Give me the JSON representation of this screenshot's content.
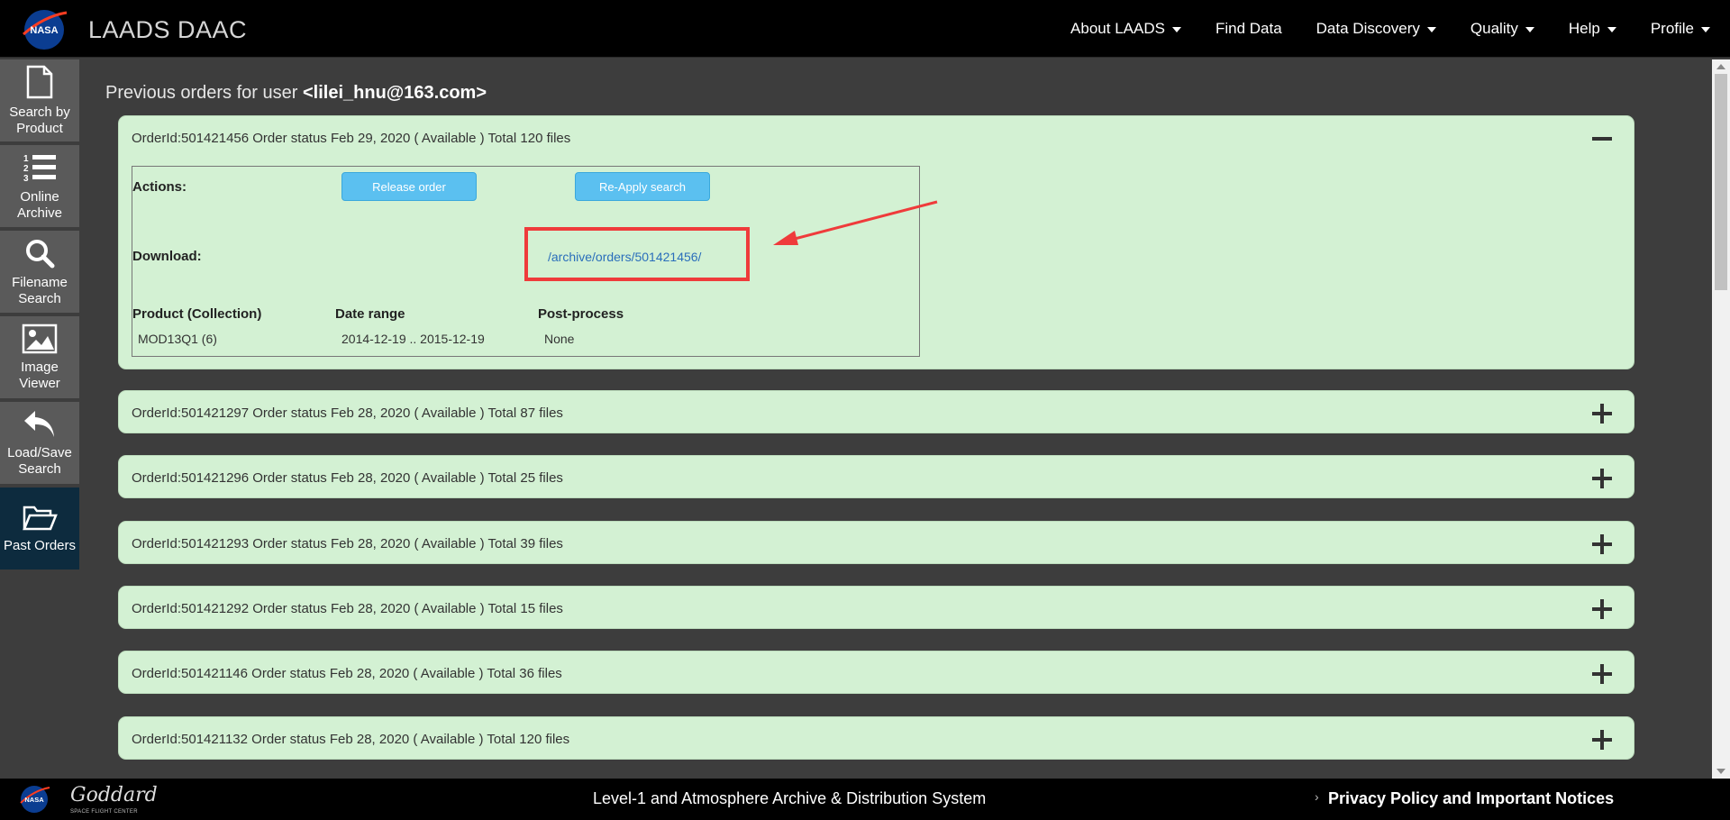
{
  "header": {
    "logo_text": "NASA",
    "brand": "LAADS DAAC",
    "nav": [
      {
        "label": "About LAADS",
        "dropdown": true
      },
      {
        "label": "Find Data",
        "dropdown": false
      },
      {
        "label": "Data Discovery",
        "dropdown": true
      },
      {
        "label": "Quality",
        "dropdown": true
      },
      {
        "label": "Help",
        "dropdown": true
      },
      {
        "label": "Profile",
        "dropdown": true
      }
    ]
  },
  "sidebar": {
    "items": [
      {
        "label": "Search by Product",
        "icon": "file-icon"
      },
      {
        "label": "Online Archive",
        "icon": "numbered-list-icon"
      },
      {
        "label": "Filename Search",
        "icon": "search-icon"
      },
      {
        "label": "Image Viewer",
        "icon": "image-icon"
      },
      {
        "label": "Load/Save Search",
        "icon": "undo-arrow-icon"
      },
      {
        "label": "Past Orders",
        "icon": "folder-open-icon",
        "active": true
      }
    ]
  },
  "main": {
    "title_prefix": "Previous orders for user",
    "user": "<lilei_hnu@163.com>",
    "expanded_order": {
      "header": "OrderId:501421456 Order status Feb 29, 2020 ( Available ) Total 120 files",
      "actions_label": "Actions:",
      "release_button": "Release order",
      "reapply_button": "Re-Apply search",
      "download_label": "Download:",
      "download_link": "/archive/orders/501421456/",
      "columns": [
        "Product (Collection)",
        "Date range",
        "Post-process"
      ],
      "row": [
        "MOD13Q1 (6)",
        "2014-12-19 .. 2015-12-19",
        "None"
      ]
    },
    "orders": [
      "OrderId:501421297 Order status Feb 28, 2020 ( Available ) Total 87 files",
      "OrderId:501421296 Order status Feb 28, 2020 ( Available ) Total 25 files",
      "OrderId:501421293 Order status Feb 28, 2020 ( Available ) Total 39 files",
      "OrderId:501421292 Order status Feb 28, 2020 ( Available ) Total 15 files",
      "OrderId:501421146 Order status Feb 28, 2020 ( Available ) Total 36 files",
      "OrderId:501421132 Order status Feb 28, 2020 ( Available ) Total 120 files"
    ]
  },
  "footer": {
    "nasa_logo": "NASA",
    "goddard": "Goddard",
    "goddard_sub": "SPACE FLIGHT CENTER",
    "center": "Level-1 and Atmosphere Archive & Distribution System",
    "chevron": "›",
    "privacy": "Privacy Policy and Important Notices"
  },
  "colors": {
    "order_bg": "#d3f1d3",
    "button_bg": "#5bc0f0",
    "highlight": "#ef3b3b",
    "active_sidebar": "#0d2b3e"
  }
}
